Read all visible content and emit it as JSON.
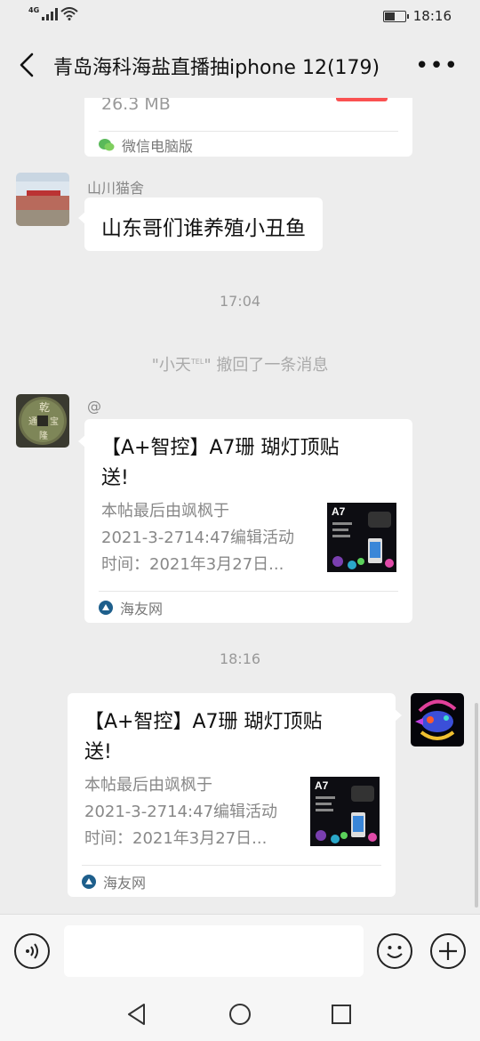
{
  "status_bar": {
    "network": "4G",
    "time": "18:16",
    "battery_level": 0.45
  },
  "header": {
    "title": "青岛海科海盐直播抽iphone 12(179)"
  },
  "messages": {
    "partial_card": {
      "size_text": "26.3 MB",
      "source": "微信电脑版"
    },
    "msg1": {
      "sender": "山川猫舍",
      "text": "山东哥们谁养殖小丑鱼"
    },
    "time1": "17:04",
    "recall": {
      "name_open": "\"小天",
      "badge": "TEL",
      "name_close": "\"",
      "action": "撤回了一条消息"
    },
    "msg2": {
      "sender": "@",
      "title_line1": "【A+智控】A7珊 瑚灯顶贴",
      "title_line2": "送!",
      "desc_line1": "本帖最后由飒枫于",
      "desc_line2": "2021-3-2714:47编辑活动",
      "desc_line3": "时间：2021年3月27日...",
      "thumb_label": "A7",
      "source": "海友网"
    },
    "time2": "18:16",
    "msg3": {
      "title_line1": "【A+智控】A7珊 瑚灯顶贴",
      "title_line2": "送!",
      "desc_line1": "本帖最后由飒枫于",
      "desc_line2": "2021-3-2714:47编辑活动",
      "desc_line3": "时间：2021年3月27日...",
      "thumb_label": "A7",
      "source": "海友网"
    }
  },
  "input_bar": {
    "value": ""
  },
  "colors": {
    "background": "#ededed",
    "bubble": "#ffffff",
    "accent_red": "#fa5151",
    "wechat_green": "#07c160"
  }
}
